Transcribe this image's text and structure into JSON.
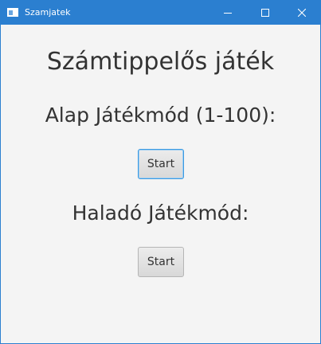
{
  "window": {
    "title": "Szamjatek",
    "controls": {
      "minimize": "minimize-icon",
      "maximize": "maximize-icon",
      "close": "close-icon"
    },
    "accent_color": "#2b7fd0"
  },
  "main": {
    "title": "Számtippelős játék",
    "basic_mode": {
      "label": "Alap Játékmód (1-100):",
      "button": "Start"
    },
    "advanced_mode": {
      "label": "Haladó Játékmód:",
      "button": "Start"
    }
  }
}
